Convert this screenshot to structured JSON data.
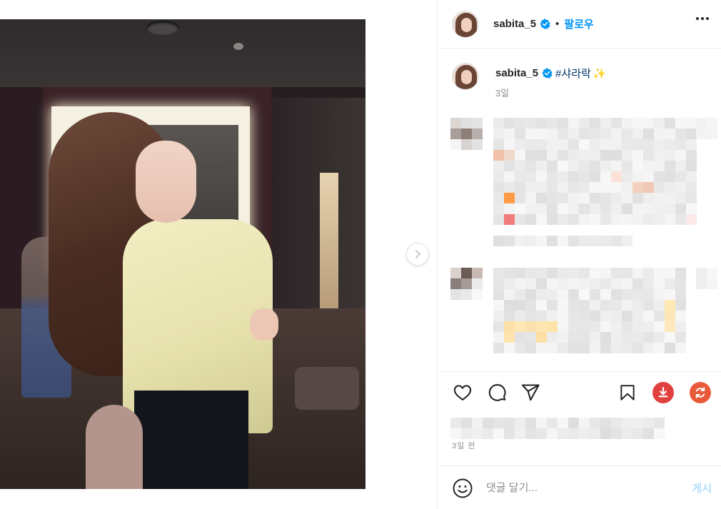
{
  "post": {
    "photo_alt": "",
    "next_icon": "chevron-right-icon"
  },
  "header": {
    "username": "sabita_5",
    "verified_icon": "verified-badge-icon",
    "separator": "•",
    "follow_label": "팔로우",
    "more_icon": "more-horizontal-icon"
  },
  "caption": {
    "username": "sabita_5",
    "text": "#샤라락",
    "sparkle": "✨",
    "time": "3일"
  },
  "actions": {
    "like_icon": "heart-icon",
    "comment_icon": "comment-icon",
    "share_icon": "send-icon",
    "save_icon": "bookmark-icon",
    "download_icon": "download-icon",
    "refresh_icon": "refresh-icon"
  },
  "post_time": "3일 전",
  "comment_box": {
    "emoji_icon": "smiley-icon",
    "placeholder": "댓글 달기...",
    "post_label": "게시"
  },
  "colors": {
    "accent": "#0095f6",
    "post_disabled": "#b2dffc",
    "download": "#e0413f",
    "refresh": "#e85a3a"
  }
}
